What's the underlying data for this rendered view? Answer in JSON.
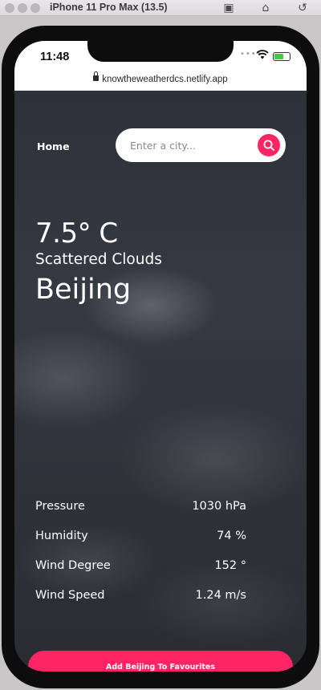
{
  "simulator": {
    "title": "iPhone 11 Pro Max (13.5)",
    "icons": [
      "screenshot-icon",
      "home-icon",
      "rotate-icon"
    ]
  },
  "status_bar": {
    "time": "11:48",
    "signal": "••••",
    "wifi": "wifi-icon",
    "battery": "battery-charging-icon",
    "battery_level": 0.6
  },
  "browser": {
    "url": "knowtheweatherdcs.netlify.app"
  },
  "nav": {
    "home_label": "Home"
  },
  "search": {
    "placeholder": "Enter a city...",
    "button_icon": "search-icon"
  },
  "weather": {
    "temperature": "7.5° C",
    "description": "Scattered Clouds",
    "city": "Beijing"
  },
  "stats": [
    {
      "label": "Pressure",
      "value": "1030 hPa"
    },
    {
      "label": "Humidity",
      "value": "74 %"
    },
    {
      "label": "Wind Degree",
      "value": "152 °"
    },
    {
      "label": "Wind Speed",
      "value": "1.24 m/s"
    }
  ],
  "actions": {
    "favourite_label": "Add Beijing To Favourites"
  },
  "colors": {
    "accent": "#ff2463",
    "background": "#2f3239",
    "text": "#ffffff"
  }
}
